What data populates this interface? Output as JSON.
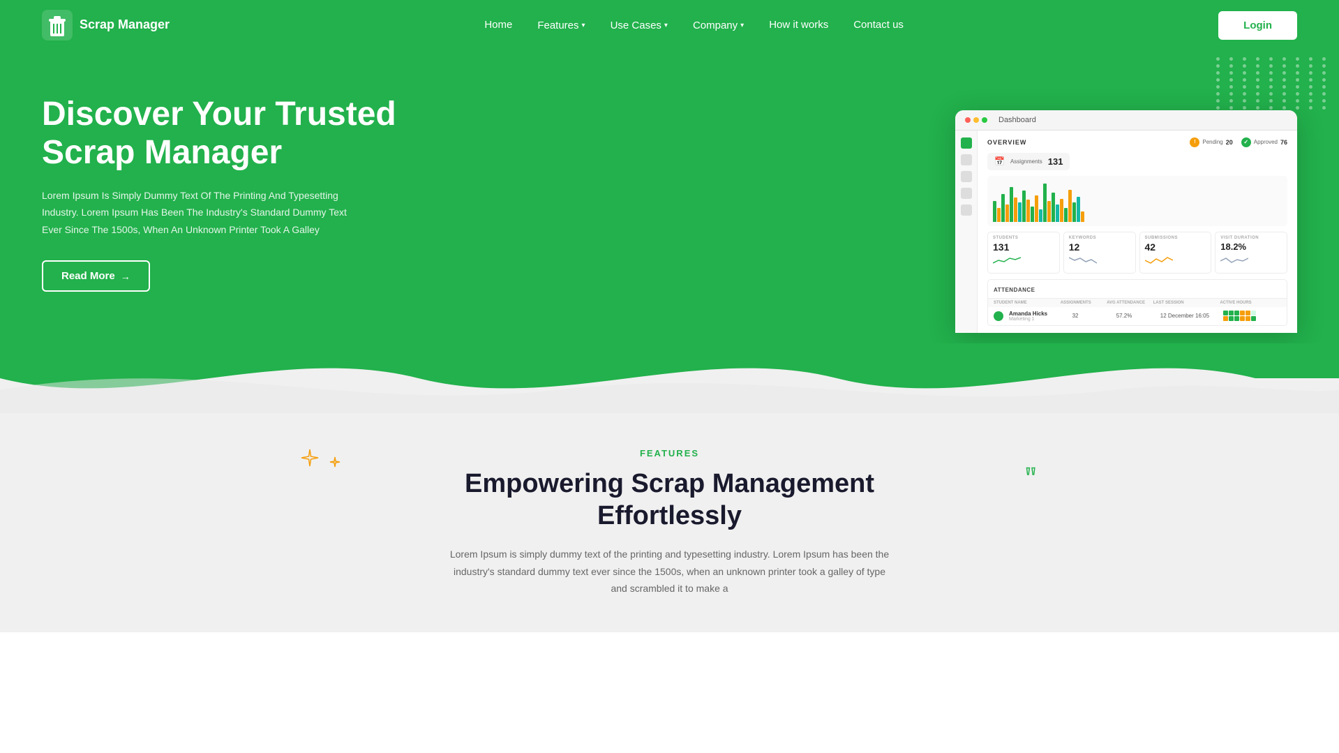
{
  "brand": {
    "name": "Scrap Manager",
    "logo_alt": "Scrap Manager Logo"
  },
  "nav": {
    "links": [
      {
        "label": "Home",
        "has_dropdown": false
      },
      {
        "label": "Features",
        "has_dropdown": true
      },
      {
        "label": "Use Cases",
        "has_dropdown": true
      },
      {
        "label": "Company",
        "has_dropdown": true
      },
      {
        "label": "How it works",
        "has_dropdown": false
      },
      {
        "label": "Contact us",
        "has_dropdown": false
      }
    ],
    "login_label": "Login"
  },
  "hero": {
    "title": "Discover Your Trusted Scrap Manager",
    "description": "Lorem Ipsum Is Simply Dummy Text Of The Printing And Typesetting Industry. Lorem Ipsum Has Been The Industry's Standard Dummy Text Ever Since The 1500s, When An Unknown Printer Took A Galley",
    "read_more_label": "Read More"
  },
  "dashboard": {
    "tab_label": "Dashboard",
    "overview_label": "OVERVIEW",
    "assignments_label": "Assignments",
    "assignments_value": "131",
    "pending_label": "Pending",
    "pending_value": "20",
    "approved_label": "Approved",
    "approved_value": "76",
    "stats": [
      {
        "label": "STUDENTS",
        "value": "131"
      },
      {
        "label": "KEYWORDS",
        "value": "12"
      },
      {
        "label": "SUBMISSIONS",
        "value": "42"
      },
      {
        "label": "VISIT DURATION",
        "value": "18.2%"
      }
    ],
    "attendance_label": "ATTENDANCE",
    "table_headers": [
      "STUDENT NAME",
      "ASSIGNMENTS",
      "AVG ATTENDANCE",
      "LAST SESSION",
      "ACTIVE HOURS"
    ],
    "table_row": {
      "name": "Amanda Hicks",
      "sub": "Marketing 1",
      "assignments": "32",
      "attendance": "57.2%",
      "last_session": "12 December 16:05"
    }
  },
  "features": {
    "section_label": "FEATURES",
    "title_line1": "Empowering Scrap Management",
    "title_line2": "Effortlessly",
    "description": "Lorem Ipsum is simply dummy text of the printing and typesetting industry. Lorem Ipsum has been the industry's standard dummy text ever since the 1500s, when an unknown printer took a galley of type and scrambled it to make a"
  },
  "colors": {
    "brand_green": "#22b14c",
    "brand_dark": "#1a1a2e",
    "accent_orange": "#f59e0b",
    "accent_teal": "#14b8a6",
    "white": "#ffffff"
  }
}
